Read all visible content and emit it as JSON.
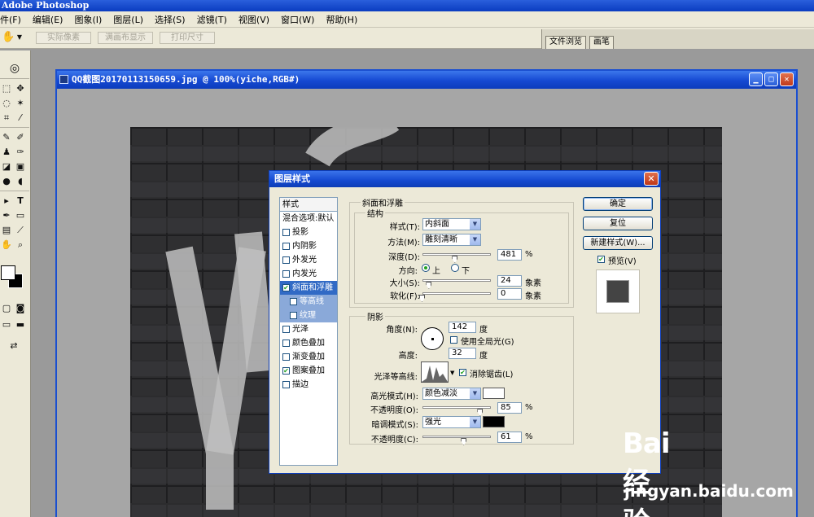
{
  "app": {
    "title": "Adobe Photoshop"
  },
  "menubar": {
    "items": [
      "件(F)",
      "编辑(E)",
      "图象(I)",
      "图层(L)",
      "选择(S)",
      "滤镜(T)",
      "视图(V)",
      "窗口(W)",
      "帮助(H)"
    ]
  },
  "options": {
    "actual_pixels": "实际像素",
    "fit_screen": "满画布显示",
    "print_size": "打印尺寸"
  },
  "palette_well": {
    "tabs": [
      "文件浏览",
      "画笔"
    ]
  },
  "document": {
    "title": "QQ截图20170113150659.jpg @ 100%(yiche,RGB#)",
    "min": "▁",
    "max": "□",
    "close": "✕"
  },
  "dialog": {
    "title": "图层样式",
    "close": "✕",
    "styles_header": "样式",
    "blend_options": "混合选项:默认",
    "style_items": [
      {
        "label": "投影",
        "checked": false
      },
      {
        "label": "内阴影",
        "checked": false
      },
      {
        "label": "外发光",
        "checked": false
      },
      {
        "label": "内发光",
        "checked": false
      },
      {
        "label": "斜面和浮雕",
        "checked": true
      },
      {
        "label": "等高线",
        "checked": false
      },
      {
        "label": "纹理",
        "checked": false
      },
      {
        "label": "光泽",
        "checked": false
      },
      {
        "label": "颜色叠加",
        "checked": false
      },
      {
        "label": "渐变叠加",
        "checked": false
      },
      {
        "label": "图案叠加",
        "checked": true
      },
      {
        "label": "描边",
        "checked": false
      }
    ],
    "bevel": {
      "section": "斜面和浮雕",
      "structure": "结构",
      "style_label": "样式(T):",
      "style_value": "内斜面",
      "technique_label": "方法(M):",
      "technique_value": "雕刻清晰",
      "depth_label": "深度(D):",
      "depth_value": "481",
      "depth_unit": "%",
      "depth_slider": 0.48,
      "direction_label": "方向:",
      "direction_up": "上",
      "direction_down": "下",
      "size_label": "大小(S):",
      "size_value": "24",
      "size_unit": "象素",
      "size_slider": 0.1,
      "soften_label": "软化(F):",
      "soften_value": "0",
      "soften_unit": "象素",
      "soften_slider": 0.0
    },
    "shading": {
      "section": "阴影",
      "angle_label": "角度(N):",
      "angle_value": "142",
      "angle_unit": "度",
      "global_light": "使用全局光(G)",
      "global_light_checked": false,
      "altitude_label": "高度:",
      "altitude_value": "32",
      "altitude_unit": "度",
      "gloss_label": "光泽等高线:",
      "antialias": "消除锯齿(L)",
      "antialias_checked": true,
      "highlight_label": "高光模式(H):",
      "highlight_value": "颜色减淡",
      "highlight_color": "#ffffff",
      "hl_opacity_label": "不透明度(O):",
      "hl_opacity_value": "85",
      "hl_opacity_unit": "%",
      "hl_opacity_slider": 0.85,
      "shadow_label": "暗调模式(S):",
      "shadow_value": "强光",
      "shadow_color": "#000000",
      "sh_opacity_label": "不透明度(C):",
      "sh_opacity_value": "61",
      "sh_opacity_unit": "%",
      "sh_opacity_slider": 0.61
    },
    "buttons": {
      "ok": "确定",
      "reset": "复位",
      "new_style": "新建样式(W)...",
      "preview": "预览(V)",
      "preview_checked": true
    }
  },
  "watermark": {
    "logo": "Bai经验",
    "domain": "jingyan.baidu.com"
  }
}
